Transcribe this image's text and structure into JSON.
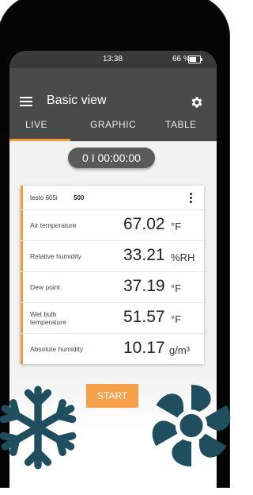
{
  "status_bar": {
    "time": "13:38",
    "battery": "66 %"
  },
  "header": {
    "title": "Basic view"
  },
  "tabs": [
    {
      "label": "LIVE",
      "active": true
    },
    {
      "label": "GRAPHIC"
    },
    {
      "label": "TABLE"
    }
  ],
  "timer": "0 I 00:00:00",
  "device": {
    "name": "testo 605i",
    "id": "500"
  },
  "readings": [
    {
      "label": "Air temperature",
      "value": "67.02",
      "unit": "°F"
    },
    {
      "label": "Relative humidity",
      "value": "33.21",
      "unit": "%RH"
    },
    {
      "label": "Dew point",
      "value": "37.19",
      "unit": "°F"
    },
    {
      "label": "Wet bulb temperature",
      "value": "51.57",
      "unit": "°F"
    },
    {
      "label": "Absolute humidity",
      "value": "10.17",
      "unit": "g/m³"
    }
  ],
  "start_label": "START",
  "colors": {
    "accent": "#f29b3b",
    "header": "#4a4a4a",
    "icon_teal": "#1f4e5f"
  },
  "icons": [
    "menu-icon",
    "gear-icon",
    "kebab-icon",
    "snowflake-icon",
    "fan-icon"
  ]
}
